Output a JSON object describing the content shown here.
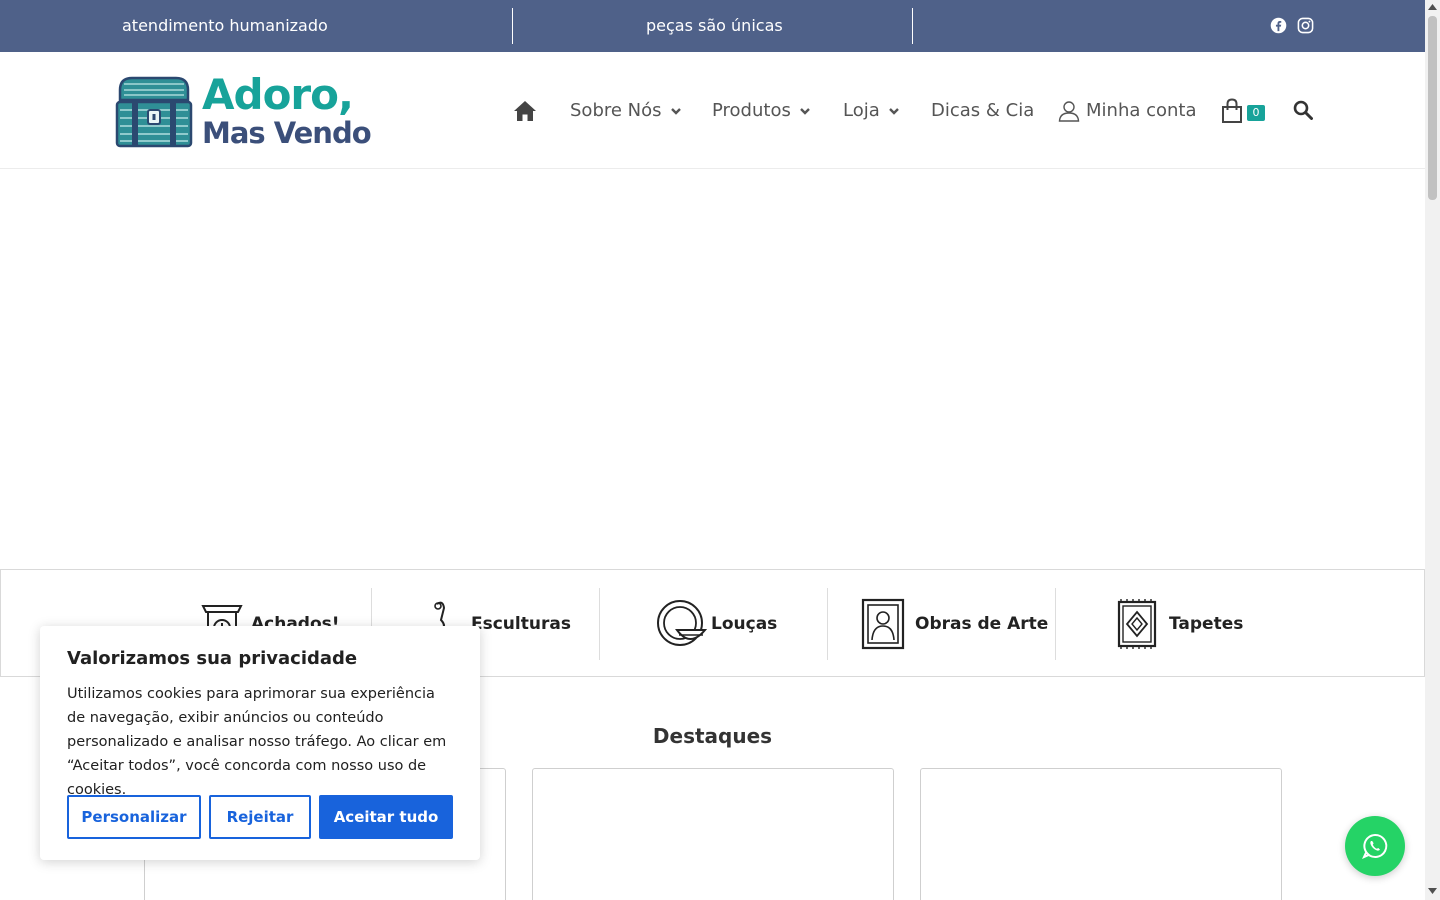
{
  "topbar": {
    "message1": "atendimento humanizado",
    "message2": "peças são únicas",
    "social": [
      "facebook-icon",
      "instagram-icon"
    ]
  },
  "brand": {
    "line1": "Adoro,",
    "line2": "Mas Vendo",
    "colors": {
      "teal": "#17a39a",
      "navy": "#3b4f7a",
      "topbar": "#4f6189"
    }
  },
  "nav": {
    "items": [
      {
        "label": "Sobre Nós",
        "has_dropdown": true
      },
      {
        "label": "Produtos",
        "has_dropdown": true
      },
      {
        "label": "Loja",
        "has_dropdown": true
      },
      {
        "label": "Dicas & Cia",
        "has_dropdown": false
      },
      {
        "label": "Minha conta",
        "has_dropdown": false
      }
    ],
    "cart_count": "0",
    "icons": [
      "home-icon",
      "user-icon",
      "shopping-bag-icon",
      "search-icon"
    ]
  },
  "categories": [
    {
      "label": "Achados!",
      "icon": "clock-icon"
    },
    {
      "label": "Esculturas",
      "icon": "sculpture-icon"
    },
    {
      "label": "Louças",
      "icon": "dishes-icon"
    },
    {
      "label": "Obras de Arte",
      "icon": "framed-portrait-icon"
    },
    {
      "label": "Tapetes",
      "icon": "rug-icon"
    }
  ],
  "featured": {
    "title": "Destaques"
  },
  "cookie": {
    "title": "Valorizamos sua privacidade",
    "body": "Utilizamos cookies para aprimorar sua experiência de navegação, exibir anúncios ou conteúdo personalizado e analisar nosso tráfego. Ao clicar em “Aceitar todos”, você concorda com nosso uso de cookies.",
    "customize": "Personalizar",
    "reject": "Rejeitar",
    "accept": "Aceitar tudo",
    "accent": "#1863dc"
  },
  "whatsapp": {
    "icon": "whatsapp-icon",
    "color": "#25d366"
  }
}
